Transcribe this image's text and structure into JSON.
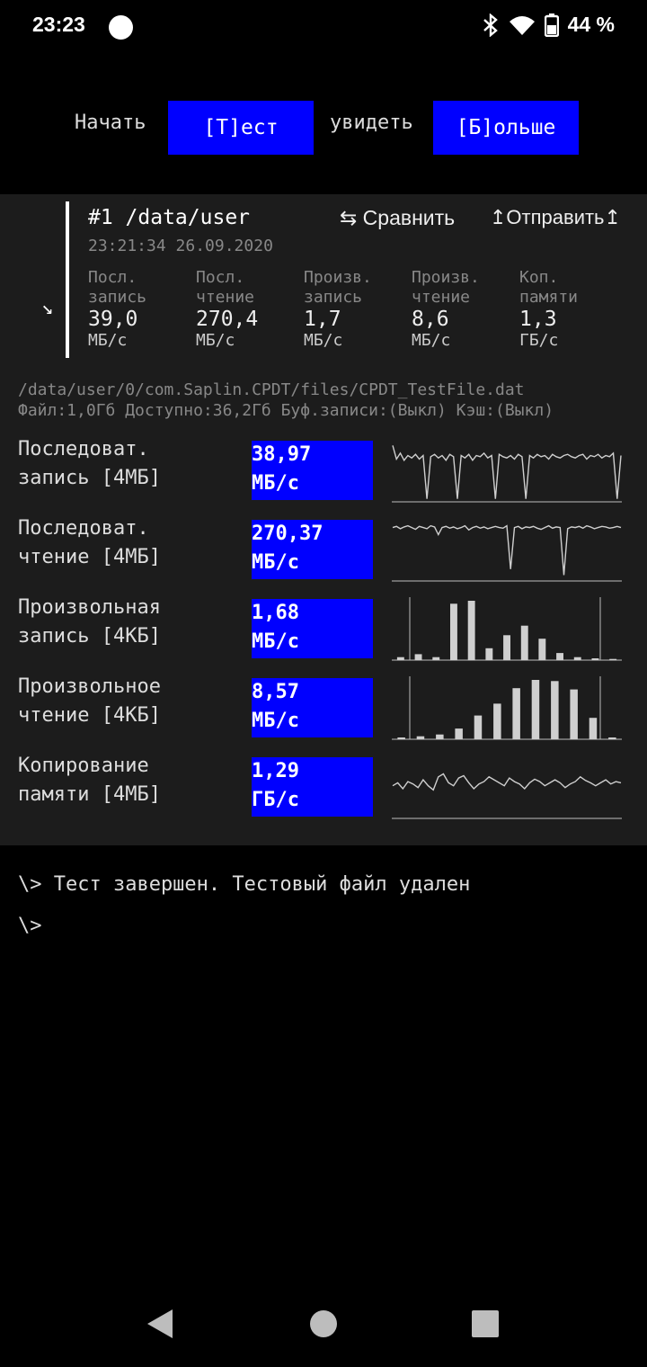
{
  "status": {
    "time": "23:23",
    "battery": "44 %",
    "icons": [
      "bluetooth-icon",
      "wifi-icon",
      "battery-icon"
    ]
  },
  "top": {
    "start_label": "Начать",
    "test_button": "[Т]ест",
    "see_label": "увидеть",
    "more_button": "[Б]ольше"
  },
  "run": {
    "title": "#1 /data/user",
    "date": "23:21:34 26.09.2020",
    "compare": "⇆ Сравнить",
    "send": "↥Отправить↥",
    "summary": [
      {
        "l1": "Посл.",
        "l2": "запись",
        "value": "39,0",
        "unit": "МБ/с"
      },
      {
        "l1": "Посл.",
        "l2": "чтение",
        "value": "270,4",
        "unit": "МБ/с"
      },
      {
        "l1": "Произв.",
        "l2": "запись",
        "value": "1,7",
        "unit": "МБ/с"
      },
      {
        "l1": "Произв.",
        "l2": "чтение",
        "value": "8,6",
        "unit": "МБ/с"
      },
      {
        "l1": "Коп.",
        "l2": "памяти",
        "value": "1,3",
        "unit": "ГБ/с"
      }
    ]
  },
  "file": {
    "path": "/data/user/0/com.Saplin.CPDT/files/CPDT_TestFile.dat",
    "info": "Файл:1,0Гб Доступно:36,2Гб Буф.записи:(Выкл) Кэш:(Выкл)"
  },
  "results": [
    {
      "l1": "Последоват.",
      "l2": "запись [4МБ]",
      "value": "38,97",
      "unit": "МБ/с"
    },
    {
      "l1": "Последоват.",
      "l2": "чтение [4МБ]",
      "value": "270,37",
      "unit": "МБ/с"
    },
    {
      "l1": "Произвольная",
      "l2": "запись [4КБ]",
      "value": "1,68",
      "unit": "МБ/с"
    },
    {
      "l1": "Произвольное",
      "l2": "чтение [4КБ]",
      "value": "8,57",
      "unit": "МБ/с"
    },
    {
      "l1": "Копирование",
      "l2": "памяти [4МБ]",
      "value": "1,29",
      "unit": "ГБ/с"
    }
  ],
  "chart_data": [
    {
      "type": "line",
      "values": [
        0.95,
        0.72,
        0.82,
        0.7,
        0.78,
        0.74,
        0.8,
        0.72,
        0.78,
        0.05,
        0.76,
        0.8,
        0.74,
        0.78,
        0.7,
        0.8,
        0.76,
        0.05,
        0.78,
        0.74,
        0.8,
        0.7,
        0.78,
        0.76,
        0.82,
        0.74,
        0.78,
        0.05,
        0.8,
        0.76,
        0.74,
        0.78,
        0.72,
        0.8,
        0.76,
        0.05,
        0.78,
        0.74,
        0.8,
        0.76,
        0.78,
        0.72,
        0.8,
        0.76,
        0.74,
        0.78,
        0.8,
        0.76,
        0.74,
        0.78,
        0.8,
        0.72,
        0.78,
        0.76,
        0.8,
        0.74,
        0.78,
        0.76,
        0.82,
        0.05,
        0.78
      ]
    },
    {
      "type": "line",
      "values": [
        0.9,
        0.92,
        0.88,
        0.91,
        0.93,
        0.9,
        0.87,
        0.92,
        0.9,
        0.88,
        0.93,
        0.91,
        0.78,
        0.9,
        0.92,
        0.89,
        0.91,
        0.88,
        0.9,
        0.93,
        0.86,
        0.9,
        0.92,
        0.89,
        0.91,
        0.88,
        0.9,
        0.92,
        0.9,
        0.89,
        0.93,
        0.2,
        0.9,
        0.92,
        0.88,
        0.91,
        0.9,
        0.92,
        0.89,
        0.87,
        0.9,
        0.93,
        0.89,
        0.91,
        0.9,
        0.1,
        0.88,
        0.91,
        0.9,
        0.92,
        0.89,
        0.93,
        0.91,
        0.88,
        0.9,
        0.92,
        0.91,
        0.89,
        0.9,
        0.92,
        0.9
      ]
    },
    {
      "type": "bar",
      "values": [
        0.05,
        0.1,
        0.05,
        0.95,
        1.0,
        0.2,
        0.42,
        0.58,
        0.36,
        0.12,
        0.05,
        0.03,
        0.02
      ]
    },
    {
      "type": "bar",
      "values": [
        0.03,
        0.05,
        0.08,
        0.18,
        0.4,
        0.6,
        0.86,
        1.0,
        0.98,
        0.84,
        0.36,
        0.03
      ]
    },
    {
      "type": "line",
      "values": [
        0.55,
        0.6,
        0.5,
        0.62,
        0.58,
        0.52,
        0.65,
        0.55,
        0.48,
        0.7,
        0.75,
        0.6,
        0.55,
        0.68,
        0.72,
        0.6,
        0.5,
        0.58,
        0.62,
        0.7,
        0.65,
        0.6,
        0.55,
        0.68,
        0.62,
        0.58,
        0.5,
        0.6,
        0.66,
        0.62,
        0.55,
        0.6,
        0.65,
        0.6,
        0.52,
        0.58,
        0.62,
        0.7,
        0.64,
        0.6,
        0.55,
        0.6,
        0.65,
        0.58,
        0.62,
        0.6
      ]
    }
  ],
  "terminal": {
    "line1": "\\> Тест завершен. Тестовый файл удален",
    "line2": "\\>"
  }
}
